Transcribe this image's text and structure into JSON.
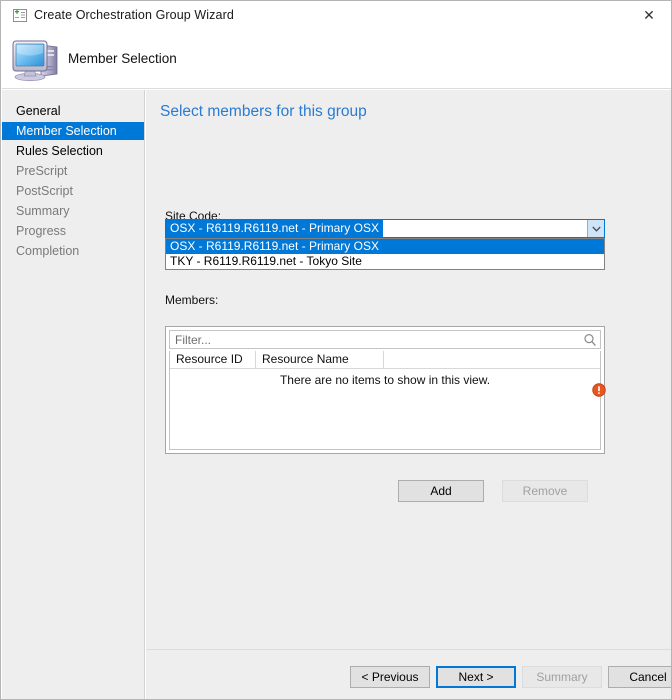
{
  "window": {
    "title": "Create Orchestration Group Wizard",
    "title_icon": "wizard-new-item-icon",
    "close_label": "✕"
  },
  "header": {
    "title": "Member Selection",
    "icon": "computer-icon"
  },
  "sidebar": {
    "items": [
      {
        "label": "General",
        "state": "completed"
      },
      {
        "label": "Member Selection",
        "state": "selected"
      },
      {
        "label": "Rules Selection",
        "state": "completed"
      },
      {
        "label": "PreScript",
        "state": "pending"
      },
      {
        "label": "PostScript",
        "state": "pending"
      },
      {
        "label": "Summary",
        "state": "pending"
      },
      {
        "label": "Progress",
        "state": "pending"
      },
      {
        "label": "Completion",
        "state": "pending"
      }
    ]
  },
  "main": {
    "heading": "Select members for this group",
    "site_code": {
      "label": "Site Code:",
      "selected": "OSX - R6119.R6119.net - Primary OSX",
      "expanded": true,
      "options": [
        "OSX - R6119.R6119.net - Primary OSX",
        "TKY - R6119.R6119.net - Tokyo Site"
      ],
      "selected_index": 0
    },
    "members": {
      "label": "Members:",
      "filter_placeholder": "Filter...",
      "filter_value": "",
      "search_icon": "magnifier-icon",
      "columns": [
        "Resource ID",
        "Resource Name"
      ],
      "rows": [],
      "empty_message": "There are no items to show in this view.",
      "validation_icon": "error-icon"
    },
    "add_label": "Add",
    "remove_label": "Remove",
    "remove_enabled": false
  },
  "footer": {
    "previous_label": "< Previous",
    "next_label": "Next >",
    "summary_label": "Summary",
    "cancel_label": "Cancel",
    "summary_enabled": false,
    "focused_button": "Next >"
  },
  "colors": {
    "accent": "#0078d7",
    "heading": "#2a7bd1",
    "panel": "#eeeeee",
    "error": "#e8551f"
  }
}
